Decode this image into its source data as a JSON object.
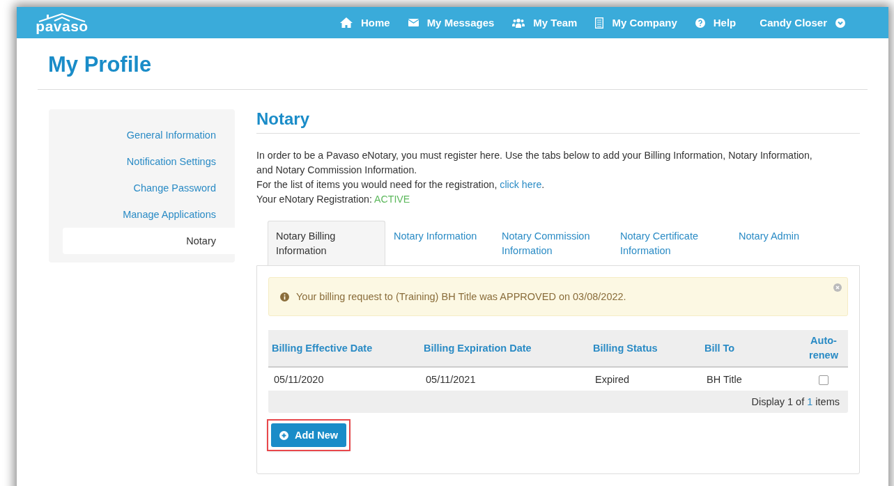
{
  "topbar": {
    "logo_text": "pavaso",
    "nav": [
      {
        "label": "Home",
        "kind": "home"
      },
      {
        "label": "My Messages",
        "kind": "mail"
      },
      {
        "label": "My Team",
        "kind": "team"
      },
      {
        "label": "My Company",
        "kind": "company"
      },
      {
        "label": "Help",
        "kind": "help"
      }
    ],
    "user": "Candy Closer"
  },
  "page_title": "My Profile",
  "sidebar": {
    "items": [
      {
        "label": "General Information",
        "selected": false
      },
      {
        "label": "Notification Settings",
        "selected": false
      },
      {
        "label": "Change Password",
        "selected": false
      },
      {
        "label": "Manage Applications",
        "selected": false
      },
      {
        "label": "Notary",
        "selected": true
      }
    ]
  },
  "section": {
    "title": "Notary",
    "intro": "In order to be a Pavaso eNotary, you must register here. Use the tabs below to add your Billing Information, Notary Information, and Notary Commission Information.",
    "list_text": "For the list of items you would need for the registration,",
    "list_link": "click here",
    "list_end": ".",
    "registration_label": "Your eNotary Registration:",
    "registration_status": "ACTIVE"
  },
  "tabs": [
    {
      "label": "Notary Billing Information",
      "selected": true
    },
    {
      "label": "Notary Information",
      "selected": false
    },
    {
      "label": "Notary Commission Information",
      "selected": false
    },
    {
      "label": "Notary Certificate Information",
      "selected": false
    },
    {
      "label": "Notary Admin",
      "selected": false
    }
  ],
  "alert": {
    "message": "Your billing request to (Training) BH Title was APPROVED on 03/08/2022."
  },
  "table": {
    "columns": [
      "Billing Effective Date",
      "Billing Expiration Date",
      "Billing Status",
      "Bill To",
      "Auto-renew"
    ],
    "rows": [
      {
        "cells": [
          "05/11/2020",
          "05/11/2021",
          "Expired",
          "BH Title"
        ],
        "auto_renew": false
      }
    ],
    "pager": {
      "prefix": "Display 1 of",
      "page": "1",
      "suffix": "items"
    }
  },
  "add_button": {
    "label": "Add New",
    "highlighted": true
  }
}
